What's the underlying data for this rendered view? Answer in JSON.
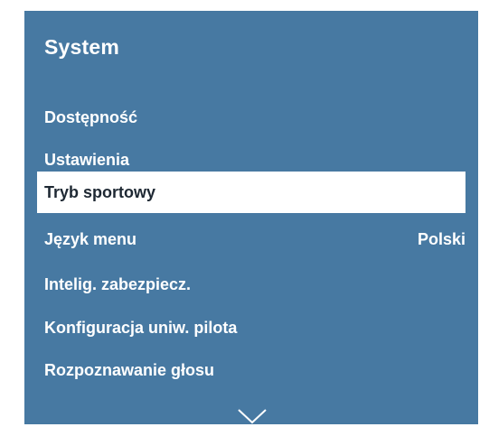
{
  "menu": {
    "title": "System",
    "items": [
      {
        "label": "Dostępność",
        "value": ""
      },
      {
        "label": "Ustawienia",
        "value": ""
      },
      {
        "label": "Tryb sportowy",
        "value": ""
      },
      {
        "label": "Język menu",
        "value": "Polski"
      },
      {
        "label": "Intelig. zabezpiecz.",
        "value": ""
      },
      {
        "label": "Konfiguracja uniw. pilota",
        "value": ""
      },
      {
        "label": "Rozpoznawanie głosu",
        "value": ""
      }
    ],
    "selected_index": 2,
    "scroll_indicator": "chevron-down-icon"
  },
  "colors": {
    "panel_background": "#4779a2",
    "text": "#ffffff",
    "selected_background": "#ffffff",
    "selected_text": "#1e2833"
  }
}
